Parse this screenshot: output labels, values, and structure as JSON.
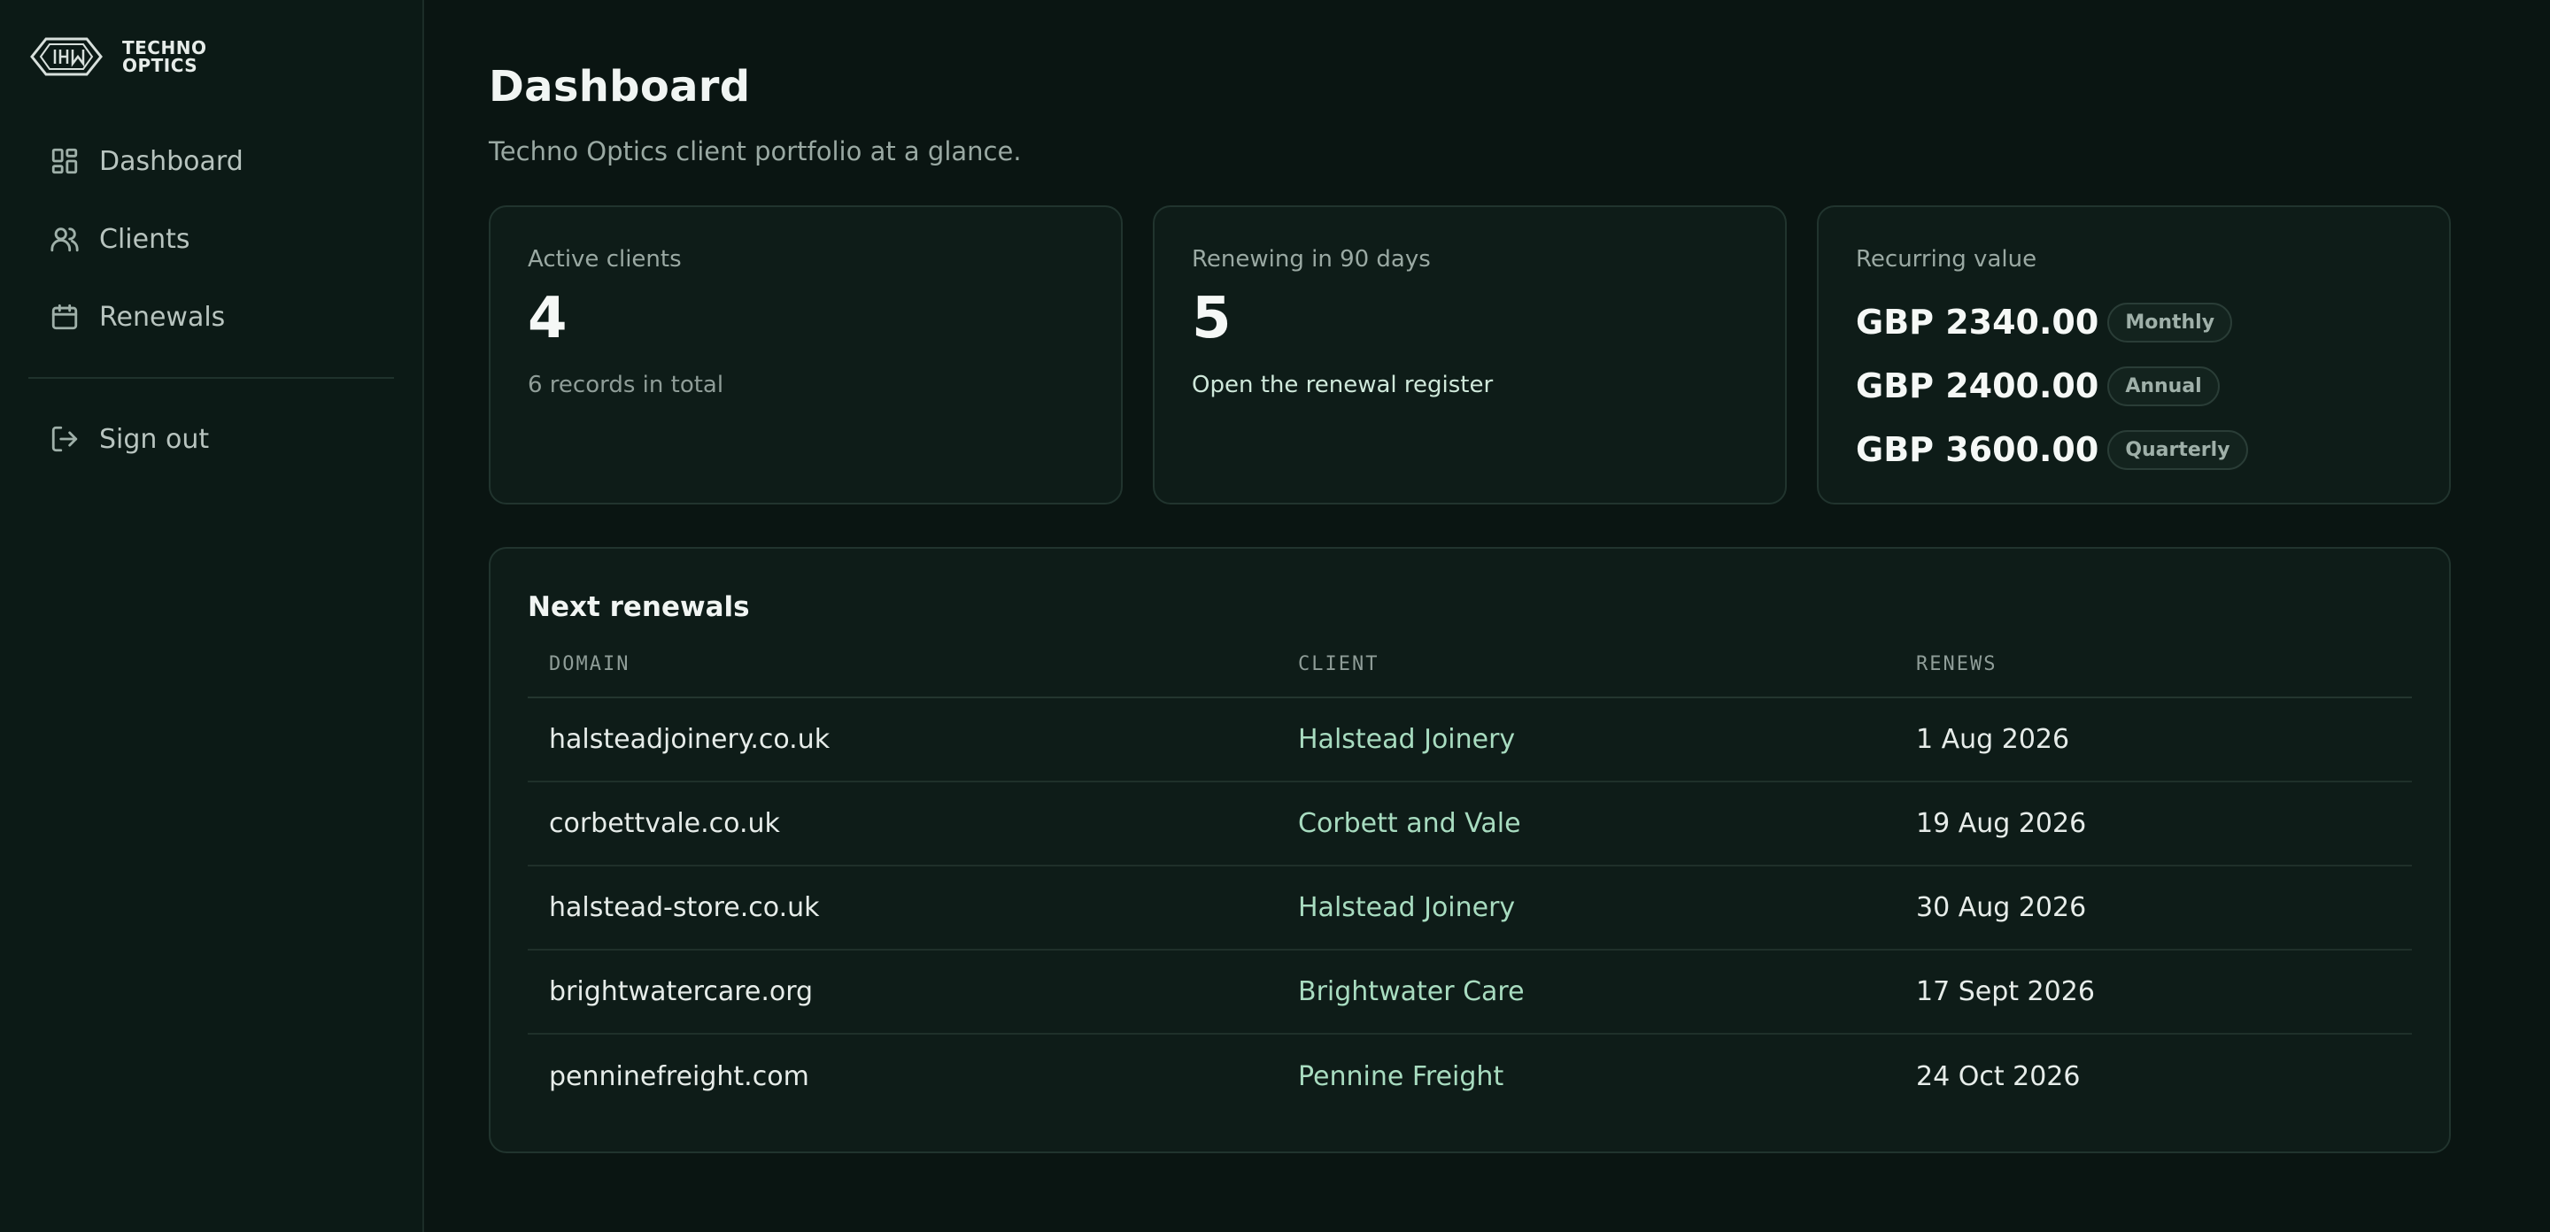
{
  "brand": {
    "name": "TECHNO\nOPTICS"
  },
  "nav": {
    "items": [
      {
        "label": "Dashboard",
        "icon": "grid-icon"
      },
      {
        "label": "Clients",
        "icon": "users-icon"
      },
      {
        "label": "Renewals",
        "icon": "calendar-icon"
      }
    ],
    "sign_out": {
      "label": "Sign out",
      "icon": "logout-icon"
    }
  },
  "page": {
    "title": "Dashboard",
    "subtitle": "Techno Optics client portfolio at a glance."
  },
  "cards": {
    "active": {
      "label": "Active clients",
      "value": "4",
      "note": "6 records in total"
    },
    "renewing": {
      "label": "Renewing in 90 days",
      "value": "5",
      "link": "Open the renewal register"
    },
    "recurring": {
      "label": "Recurring value",
      "rows": [
        {
          "amount": "GBP 2340.00",
          "period": "Monthly"
        },
        {
          "amount": "GBP 2400.00",
          "period": "Annual"
        },
        {
          "amount": "GBP 3600.00",
          "period": "Quarterly"
        }
      ]
    }
  },
  "renewals": {
    "title": "Next renewals",
    "columns": [
      "DOMAIN",
      "CLIENT",
      "RENEWS"
    ],
    "rows": [
      {
        "domain": "halsteadjoinery.co.uk",
        "client": "Halstead Joinery",
        "renews": "1 Aug 2026"
      },
      {
        "domain": "corbettvale.co.uk",
        "client": "Corbett and Vale",
        "renews": "19 Aug 2026"
      },
      {
        "domain": "halstead-store.co.uk",
        "client": "Halstead Joinery",
        "renews": "30 Aug 2026"
      },
      {
        "domain": "brightwatercare.org",
        "client": "Brightwater Care",
        "renews": "17 Sept 2026"
      },
      {
        "domain": "penninefreight.com",
        "client": "Pennine Freight",
        "renews": "24 Oct 2026"
      }
    ]
  },
  "colors": {
    "background": "#0a1512",
    "sidebar": "#0c1a16",
    "card": "#0e1c18",
    "accent_text": "#a8dcc0"
  }
}
